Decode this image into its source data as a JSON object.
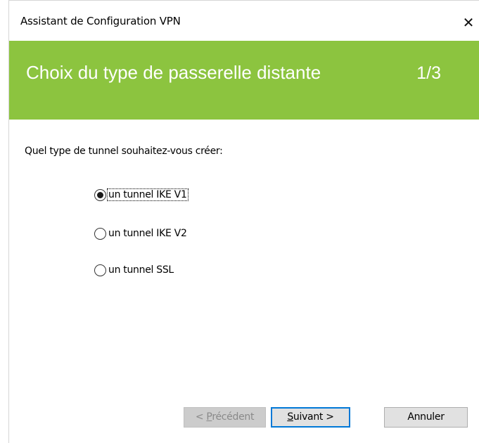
{
  "window": {
    "title": "Assistant de Configuration VPN",
    "close_glyph": "✕"
  },
  "banner": {
    "title": "Choix du type de passerelle distante",
    "step": "1/3",
    "color": "#8cc43f"
  },
  "form": {
    "question": "Quel type de tunnel souhaitez-vous créer:",
    "options": [
      {
        "label": "un tunnel IKE V1",
        "checked": true
      },
      {
        "label": "un tunnel IKE V2",
        "checked": false
      },
      {
        "label": "un tunnel SSL",
        "checked": false
      }
    ]
  },
  "buttons": {
    "prev_prefix": "< ",
    "prev_mnemonic": "P",
    "prev_rest": "récédent",
    "prev_enabled": false,
    "next_mnemonic": "S",
    "next_rest": "uivant >",
    "cancel_label": "Annuler"
  },
  "accent_color": "#0078d7"
}
